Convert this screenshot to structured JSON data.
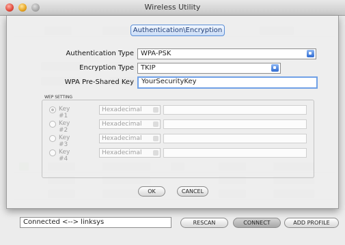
{
  "window": {
    "title": "Wireless Utility"
  },
  "dialog": {
    "tab_label": "Authentication\\Encryption",
    "auth_type": {
      "label": "Authentication Type",
      "value": "WPA-PSK"
    },
    "enc_type": {
      "label": "Encryption Type",
      "value": "TKIP"
    },
    "psk": {
      "label": "WPA Pre-Shared Key",
      "value": "YourSecurityKey"
    },
    "wep": {
      "title": "WEP SETTING",
      "keys": [
        {
          "label": "Key #1",
          "format": "Hexadecimal",
          "selected": true
        },
        {
          "label": "Key #2",
          "format": "Hexadecimal",
          "selected": false
        },
        {
          "label": "Key #3",
          "format": "Hexadecimal",
          "selected": false
        },
        {
          "label": "Key #4",
          "format": "Hexadecimal",
          "selected": false
        }
      ]
    },
    "ok_label": "OK",
    "cancel_label": "CANCEL"
  },
  "footer": {
    "status": "Connected <--> linksys",
    "rescan_label": "RESCAN",
    "connect_label": "CONNECT",
    "add_profile_label": "ADD PROFILE"
  },
  "colors": {
    "accent": "#2e6ad1",
    "focus": "#6fa0e6"
  }
}
